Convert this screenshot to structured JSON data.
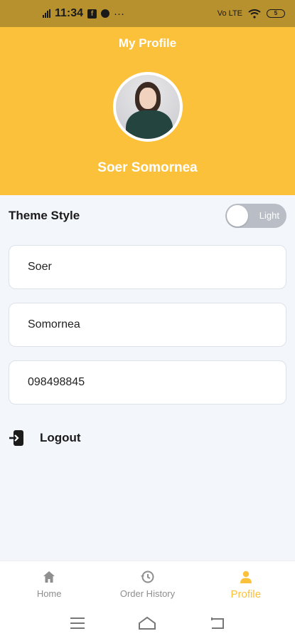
{
  "status_bar": {
    "time": "11:34",
    "network": "Vo LTE",
    "battery_level": "5"
  },
  "header": {
    "title": "My Profile",
    "name": "Soer Somornea"
  },
  "theme": {
    "label": "Theme Style",
    "toggle_text": "Light"
  },
  "fields": {
    "first_name": "Soer",
    "last_name": "Somornea",
    "phone": "098498845"
  },
  "logout": {
    "label": "Logout"
  },
  "nav": {
    "items": [
      {
        "label": "Home",
        "icon": "home-icon"
      },
      {
        "label": "Order History",
        "icon": "history-icon"
      },
      {
        "label": "Profile",
        "icon": "person-icon"
      }
    ],
    "active": "Profile"
  },
  "colors": {
    "accent": "#fcc13a",
    "status_bar": "#b8912f",
    "background": "#f3f6fb",
    "inactive": "#8e8e8e"
  }
}
